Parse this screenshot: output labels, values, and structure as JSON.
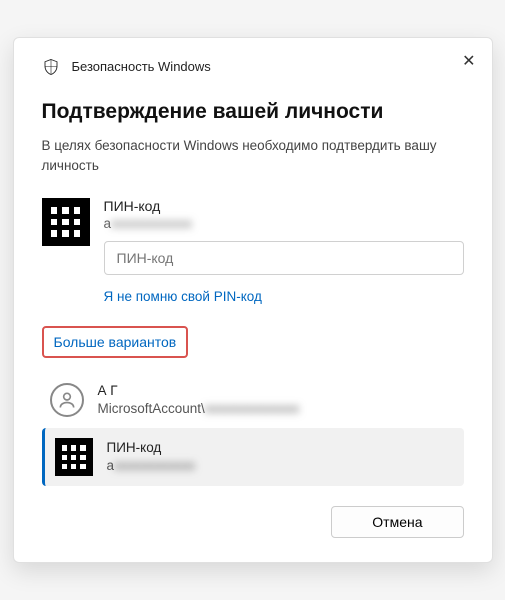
{
  "window_title": "Безопасность Windows",
  "heading": "Подтверждение вашей личности",
  "subtext": "В целях безопасности Windows необходимо подтвердить вашу личность",
  "pin": {
    "label": "ПИН-код",
    "email": "a██████████",
    "placeholder": "ПИН-код"
  },
  "forgot_pin": "Я не помню свой PIN-код",
  "more_options": "Больше вариантов",
  "options": {
    "account": {
      "name": "А Г",
      "sub": "MicrosoftAccount\\████████"
    },
    "pin": {
      "label": "ПИН-код",
      "email": "a██████████"
    }
  },
  "cancel": "Отмена"
}
